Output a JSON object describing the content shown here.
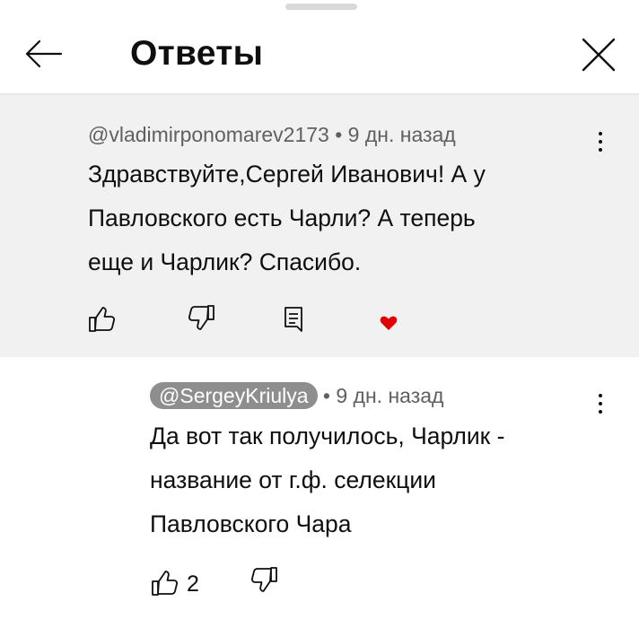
{
  "header": {
    "title": "Ответы"
  },
  "parent_comment": {
    "author": "@vladimirponomarev2173",
    "separator": "•",
    "time": "9 дн. назад",
    "text": "Здравствуйте,Сергей Иванович! А у\nПавловского есть Чарли? А теперь\nеще и Чарлик? Спасибо.",
    "creator_heart": true
  },
  "reply_comment": {
    "author": "@SergeyKriulya",
    "separator": "•",
    "time": "9 дн. назад",
    "text": "Да вот так получилось, Чарлик -\nназвание от г.ф. селекции\nПавловского Чара",
    "like_count": "2"
  },
  "colors": {
    "parent_bg": "#f1f1f1",
    "heart": "#e00000",
    "author_chip_bg": "#8e8e8e",
    "meta_text": "#606060"
  }
}
